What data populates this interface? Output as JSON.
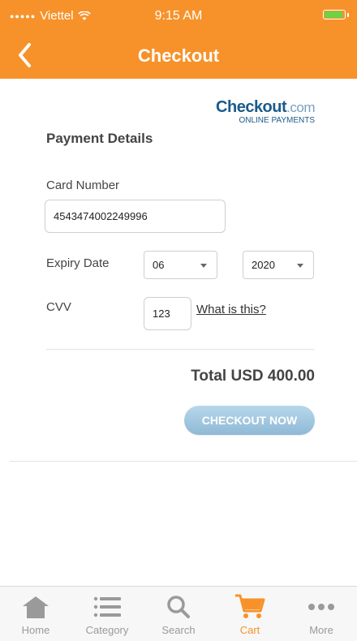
{
  "status_bar": {
    "carrier": "Viettel",
    "time": "9:15 AM"
  },
  "nav": {
    "title": "Checkout"
  },
  "brand": {
    "name": "Checkout",
    "suffix": ".com",
    "tagline": "ONLINE PAYMENTS"
  },
  "payment": {
    "title": "Payment Details",
    "card_number_label": "Card Number",
    "card_number_value": "4543474002249996",
    "expiry_label": "Expiry Date",
    "expiry_month": "06",
    "expiry_year": "2020",
    "cvv_label": "CVV",
    "cvv_value": "123",
    "what_is_this": "What is this?"
  },
  "total": {
    "text": "Total USD 400.00"
  },
  "checkout_button": {
    "label": "CHECKOUT NOW"
  },
  "tabbar": {
    "items": [
      {
        "label": "Home",
        "icon": "home-icon"
      },
      {
        "label": "Category",
        "icon": "list-icon"
      },
      {
        "label": "Search",
        "icon": "search-icon"
      },
      {
        "label": "Cart",
        "icon": "cart-icon"
      },
      {
        "label": "More",
        "icon": "more-icon"
      }
    ],
    "active": "Cart",
    "active_color": "#f7922a",
    "inactive_color": "#9a9a9a"
  },
  "colors": {
    "header": "#f7922a",
    "button": "#8fb9d6"
  }
}
